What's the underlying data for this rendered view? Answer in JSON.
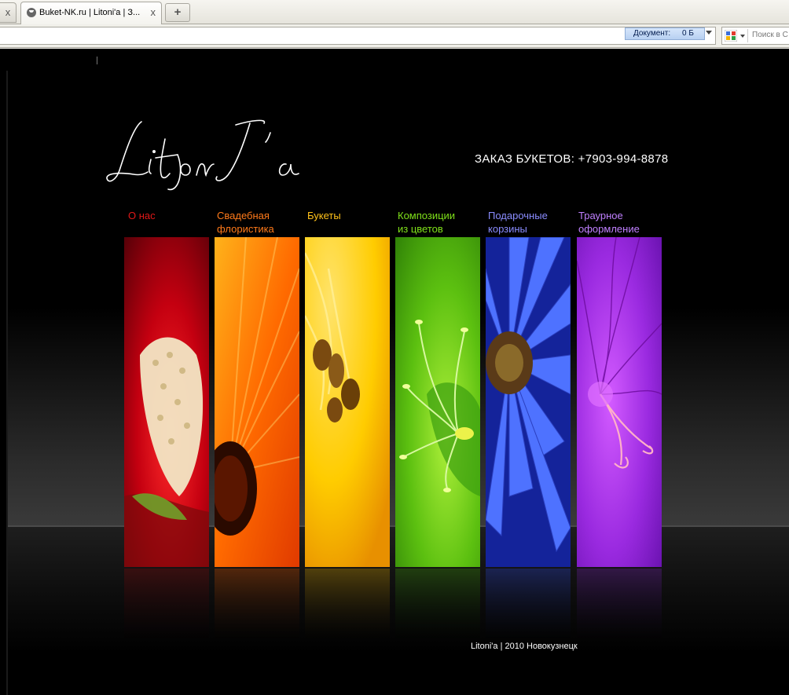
{
  "browser": {
    "tab_title": "Buket-NK.ru | Litoni'a | З...",
    "tab_close_glyph": "x",
    "left_close_glyph": "x",
    "newtab_glyph": "+",
    "doc_size_label": "Документ:",
    "doc_size_value": "0 Б",
    "search_placeholder": "Поиск в С"
  },
  "site": {
    "phone_text": "ЗАКАЗ БУКЕТОВ: +7903-994-8878",
    "menu": [
      {
        "line1": "",
        "line2": "О нас",
        "color": "#e01818"
      },
      {
        "line1": "Свадебная",
        "line2": "флористика",
        "color": "#ff7a1a"
      },
      {
        "line1": "",
        "line2": "Букеты",
        "color": "#ffc21a"
      },
      {
        "line1": "Композиции",
        "line2": "из цветов",
        "color": "#7fe01a"
      },
      {
        "line1": "Подарочные",
        "line2": "корзины",
        "color": "#8a8cff"
      },
      {
        "line1": "Траурное",
        "line2": "оформление",
        "color": "#c080ff"
      }
    ],
    "footer": "Litoni'a | 2010 Новокузнецк"
  }
}
